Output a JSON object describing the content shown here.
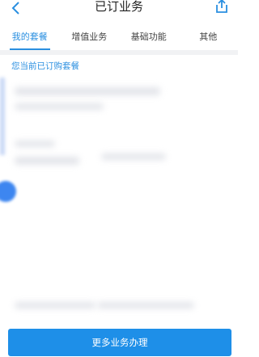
{
  "header": {
    "title": "已订业务"
  },
  "tabs": [
    {
      "label": "我的套餐",
      "active": true
    },
    {
      "label": "增值业务",
      "active": false
    },
    {
      "label": "基础功能",
      "active": false
    },
    {
      "label": "其他",
      "active": false
    }
  ],
  "section": {
    "label": "您当前已订购套餐"
  },
  "footer": {
    "button_label": "更多业务办理"
  },
  "colors": {
    "accent": "#2a8fe0",
    "button": "#1e8fe8"
  }
}
